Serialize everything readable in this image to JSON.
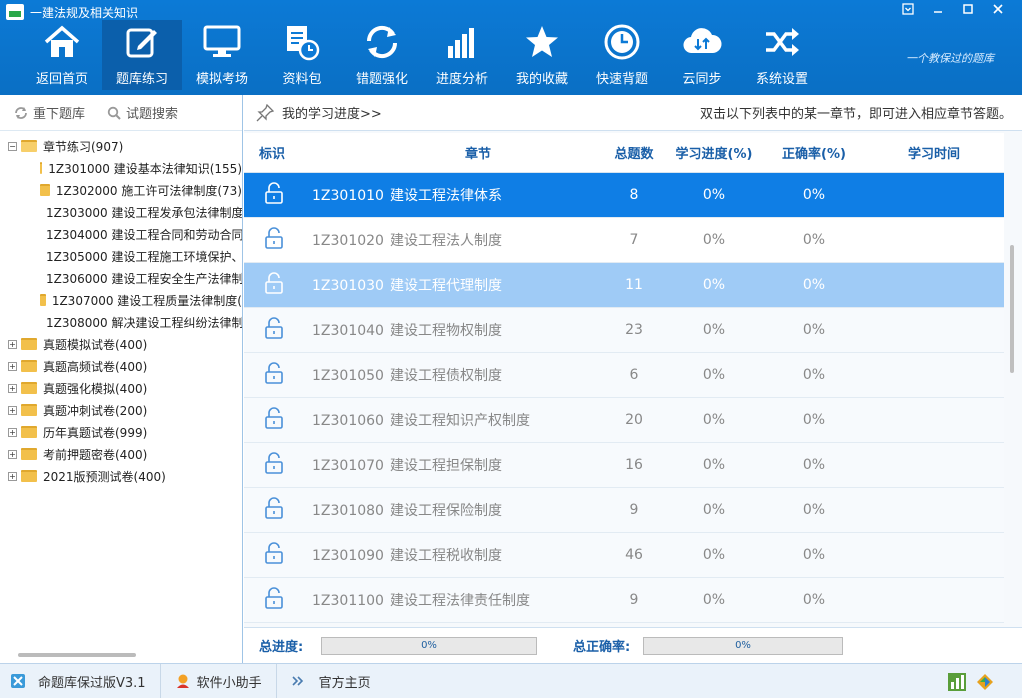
{
  "window": {
    "title": "一建法规及相关知识",
    "controls": [
      "menu",
      "minimize",
      "maximize",
      "close"
    ]
  },
  "nav": [
    {
      "label": "返回首页",
      "icon": "home-icon"
    },
    {
      "label": "题库练习",
      "icon": "edit-icon",
      "active": true
    },
    {
      "label": "模拟考场",
      "icon": "monitor-icon"
    },
    {
      "label": "资料包",
      "icon": "document-clock-icon"
    },
    {
      "label": "错题强化",
      "icon": "refresh-icon"
    },
    {
      "label": "进度分析",
      "icon": "bar-chart-icon"
    },
    {
      "label": "我的收藏",
      "icon": "star-icon"
    },
    {
      "label": "快速背题",
      "icon": "clock-icon"
    },
    {
      "label": "云同步",
      "icon": "cloud-sync-icon"
    },
    {
      "label": "系统设置",
      "icon": "shuffle-icon"
    }
  ],
  "slogan": "一个教保过的题库",
  "left": {
    "reset_label": "重下题库",
    "search_label": "试题搜索",
    "tree": {
      "root": "章节练习(907)",
      "chapters": [
        "1Z301000 建设基本法律知识(155)",
        "1Z302000 施工许可法律制度(73)",
        "1Z303000 建设工程发承包法律制度",
        "1Z304000 建设工程合同和劳动合同",
        "1Z305000 建设工程施工环境保护、",
        "1Z306000 建设工程安全生产法律制",
        "1Z307000 建设工程质量法律制度(",
        "1Z308000 解决建设工程纠纷法律制"
      ],
      "others": [
        "真题模拟试卷(400)",
        "真题高频试卷(400)",
        "真题强化模拟(400)",
        "真题冲刺试卷(200)",
        "历年真题试卷(999)",
        "考前押题密卷(400)",
        "2021版预测试卷(400)"
      ]
    }
  },
  "right": {
    "progress_link": "我的学习进度>>",
    "hint": "双击以下列表中的某一章节，即可进入相应章节答题。",
    "columns": [
      "标识",
      "章节",
      "总题数",
      "学习进度(%)",
      "正确率(%)",
      "学习时间"
    ],
    "rows": [
      {
        "code": "1Z301010",
        "name": "建设工程法律体系",
        "total": "8",
        "progress": "0%",
        "accuracy": "0%",
        "time": ""
      },
      {
        "code": "1Z301020",
        "name": "建设工程法人制度",
        "total": "7",
        "progress": "0%",
        "accuracy": "0%",
        "time": ""
      },
      {
        "code": "1Z301030",
        "name": "建设工程代理制度",
        "total": "11",
        "progress": "0%",
        "accuracy": "0%",
        "time": ""
      },
      {
        "code": "1Z301040",
        "name": "建设工程物权制度",
        "total": "23",
        "progress": "0%",
        "accuracy": "0%",
        "time": ""
      },
      {
        "code": "1Z301050",
        "name": "建设工程债权制度",
        "total": "6",
        "progress": "0%",
        "accuracy": "0%",
        "time": ""
      },
      {
        "code": "1Z301060",
        "name": "建设工程知识产权制度",
        "total": "20",
        "progress": "0%",
        "accuracy": "0%",
        "time": ""
      },
      {
        "code": "1Z301070",
        "name": "建设工程担保制度",
        "total": "16",
        "progress": "0%",
        "accuracy": "0%",
        "time": ""
      },
      {
        "code": "1Z301080",
        "name": "建设工程保险制度",
        "total": "9",
        "progress": "0%",
        "accuracy": "0%",
        "time": ""
      },
      {
        "code": "1Z301090",
        "name": "建设工程税收制度",
        "total": "46",
        "progress": "0%",
        "accuracy": "0%",
        "time": ""
      },
      {
        "code": "1Z301100",
        "name": "建设工程法律责任制度",
        "total": "9",
        "progress": "0%",
        "accuracy": "0%",
        "time": ""
      }
    ],
    "total_progress_label": "总进度:",
    "total_progress_value": "0%",
    "total_progress_fraction": 0,
    "total_accuracy_label": "总正确率:",
    "total_accuracy_value": "0%",
    "total_accuracy_fraction": 0
  },
  "status": {
    "version": "命题库保过版V3.1",
    "helper": "软件小助手",
    "homepage": "官方主页"
  },
  "colors": {
    "titlebar": "#0c7ad6",
    "selected_row": "#0f7ee5",
    "hover_row": "#9fcbf6",
    "header_text": "#1a5fa8"
  }
}
